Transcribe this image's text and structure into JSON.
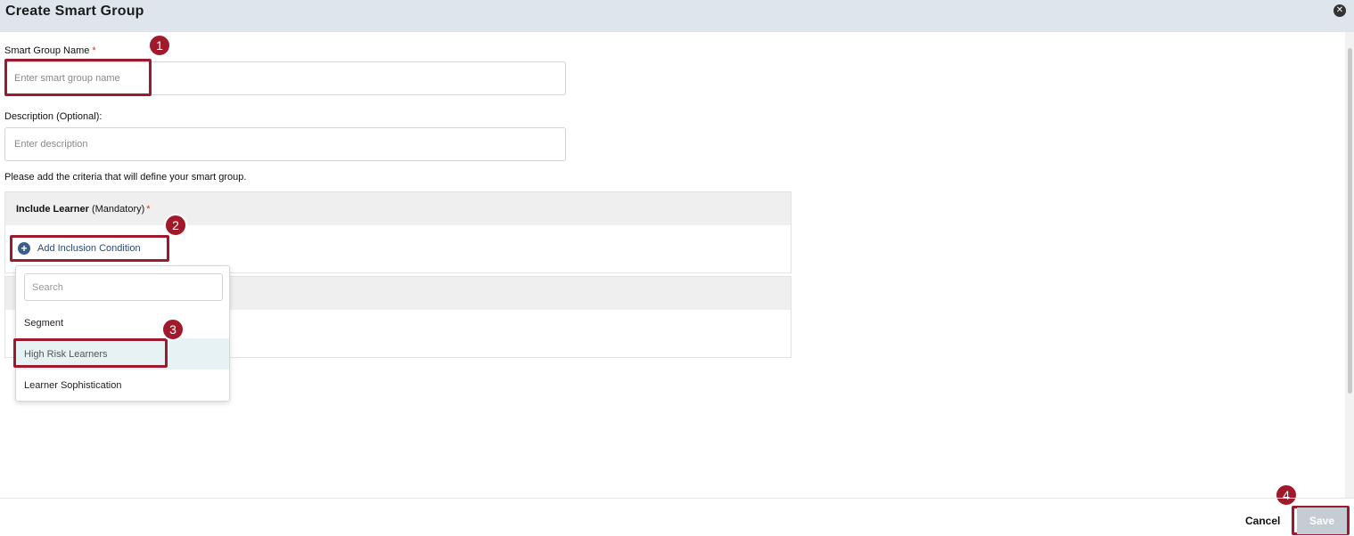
{
  "header": {
    "title": "Create Smart Group"
  },
  "form": {
    "name_label": "Smart Group Name",
    "required_mark": "*",
    "name_placeholder": "Enter smart group name",
    "description_label": "Description (Optional):",
    "description_placeholder": "Enter description",
    "criteria_text": "Please add the criteria that will define your smart group."
  },
  "include_section": {
    "title_bold": "Include Learner",
    "title_suffix": "(Mandatory)",
    "required_mark": "*",
    "add_label": "Add Inclusion Condition"
  },
  "dropdown": {
    "search_placeholder": "Search",
    "items": [
      "Segment",
      "High Risk Learners",
      "Learner Sophistication"
    ],
    "highlighted_item": "High Risk Learners"
  },
  "callouts": [
    "1",
    "2",
    "3",
    "4"
  ],
  "footer": {
    "cancel_label": "Cancel",
    "save_label": "Save"
  },
  "colors": {
    "callout": "#a11a2c",
    "header_bg": "#dfe5ec",
    "save_bg": "#c5ccd4"
  }
}
